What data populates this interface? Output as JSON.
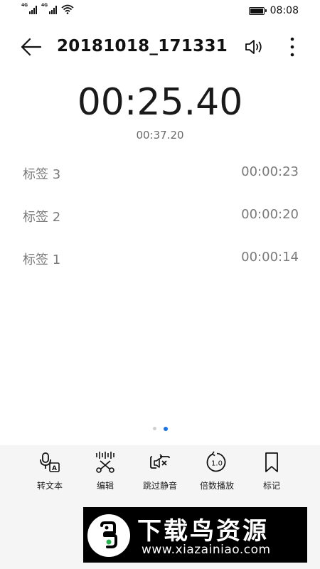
{
  "status_bar": {
    "network_1": "4G",
    "network_2": "4G",
    "time": "08:08"
  },
  "header": {
    "title": "20181018_171331"
  },
  "player": {
    "current_time": "00:25.40",
    "total_duration": "00:37.20"
  },
  "tags": [
    {
      "name": "标签 3",
      "time": "00:00:23"
    },
    {
      "name": "标签 2",
      "time": "00:00:20"
    },
    {
      "name": "标签 1",
      "time": "00:00:14"
    }
  ],
  "pager": {
    "count": 2,
    "active_index": 1
  },
  "toolbar": {
    "items": [
      {
        "label": "转文本",
        "icon": "speech-to-text-icon"
      },
      {
        "label": "编辑",
        "icon": "scissors-icon"
      },
      {
        "label": "跳过静音",
        "icon": "skip-silence-icon"
      },
      {
        "label": "倍数播放",
        "icon": "playback-speed-icon"
      },
      {
        "label": "标记",
        "icon": "bookmark-icon"
      }
    ]
  },
  "watermark": {
    "title": "下载鸟资源",
    "url": "www.xiazainiao.com"
  },
  "colors": {
    "accent": "#1a73e8",
    "toolbar_bg": "#f5f5f5",
    "secondary_text": "#7a7a7a"
  }
}
